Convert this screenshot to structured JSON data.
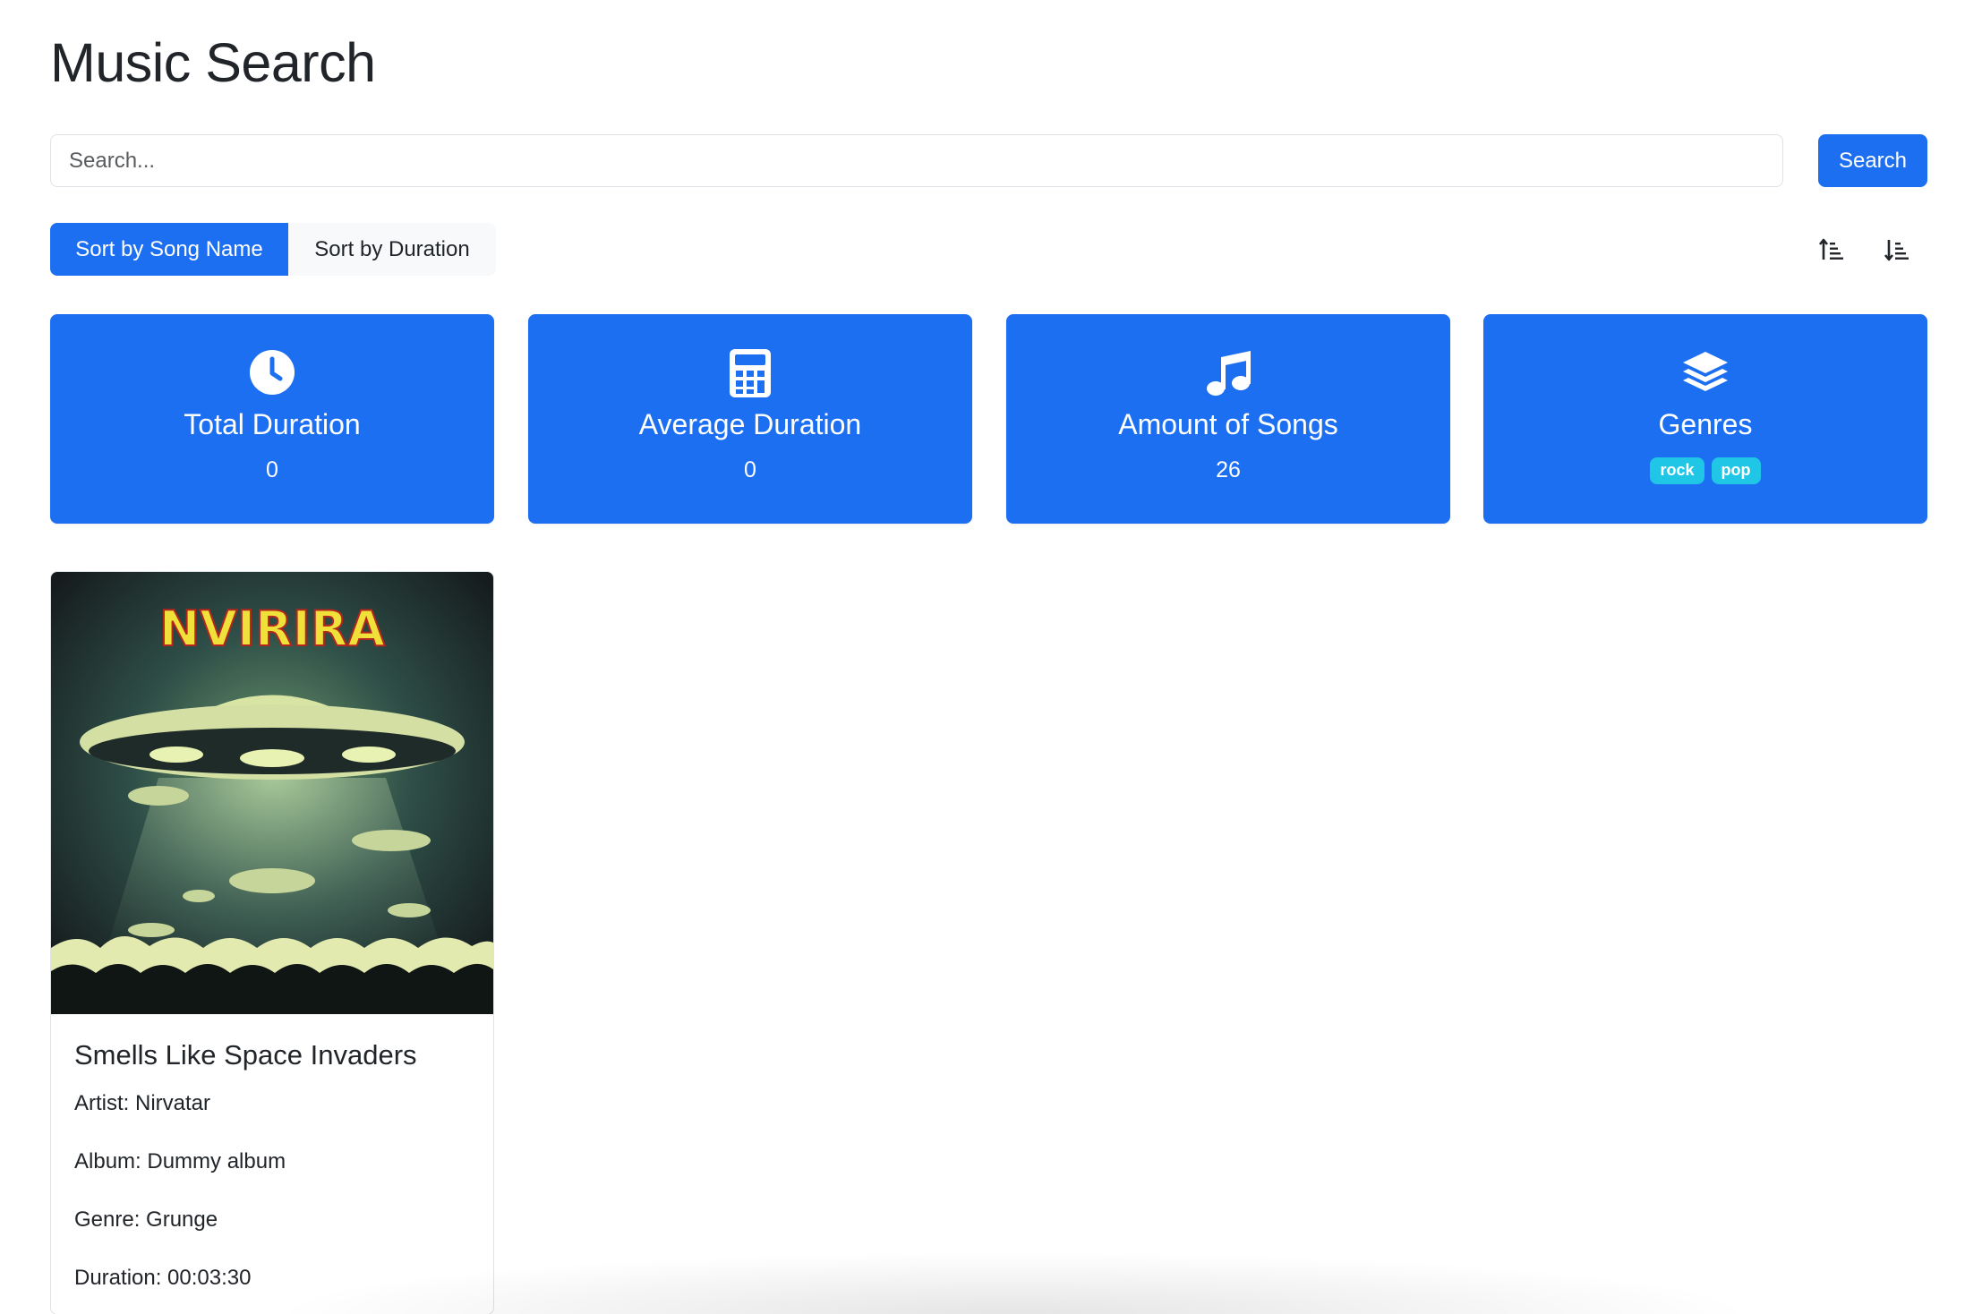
{
  "header": {
    "title": "Music Search"
  },
  "search": {
    "placeholder": "Search...",
    "value": "",
    "button_label": "Search"
  },
  "sort": {
    "options": [
      {
        "label": "Sort by Song Name",
        "active": true
      },
      {
        "label": "Sort by Duration",
        "active": false
      }
    ],
    "asc_icon": "sort-numeric-up-icon",
    "desc_icon": "sort-numeric-down-icon"
  },
  "stats": {
    "total_duration": {
      "label": "Total Duration",
      "value": "0",
      "icon": "clock-icon"
    },
    "average_duration": {
      "label": "Average Duration",
      "value": "0",
      "icon": "calculator-icon"
    },
    "amount_of_songs": {
      "label": "Amount of Songs",
      "value": "26",
      "icon": "music-note-icon"
    },
    "genres": {
      "label": "Genres",
      "icon": "layers-icon",
      "tags": [
        "rock",
        "pop"
      ]
    }
  },
  "songs": [
    {
      "cover_text": "NVIRIRA",
      "title": "Smells Like Space Invaders",
      "artist": "Artist: Nirvatar",
      "album": "Album: Dummy album",
      "genre": "Genre: Grunge",
      "duration": "Duration: 00:03:30"
    }
  ],
  "colors": {
    "primary": "#1d6ff2",
    "badge": "#1fc6e6",
    "text": "#212529",
    "border": "#dee2e6"
  }
}
